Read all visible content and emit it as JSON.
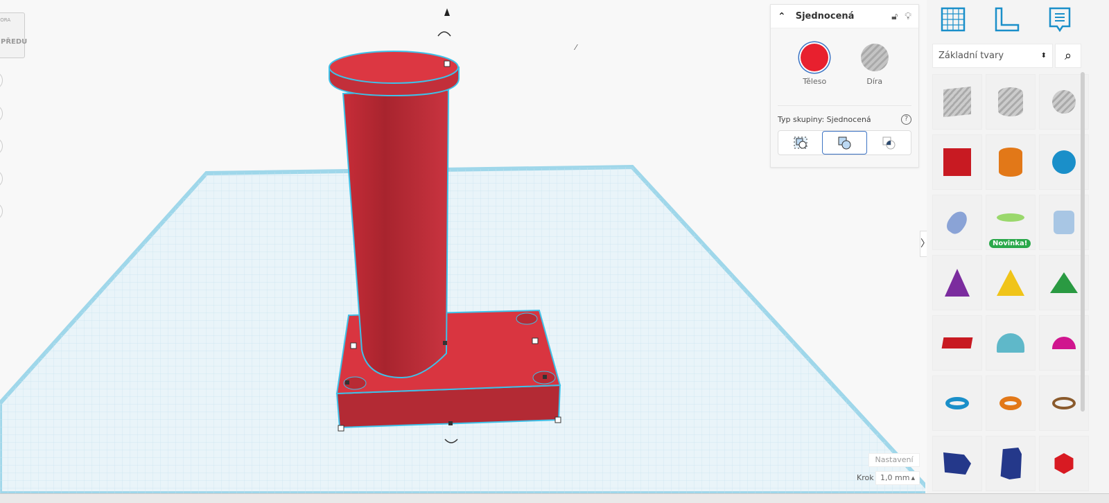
{
  "viewcube": {
    "top": "HORA",
    "front": "PŘEDU"
  },
  "inspector": {
    "title": "Sjednocená",
    "solid_label": "Těleso",
    "hole_label": "Díra",
    "group_type_label": "Typ skupiny: Sjednocená",
    "help": "?",
    "solid_color": "#e8202e"
  },
  "panel": {
    "category": "Základní tvary",
    "new_badge": "Novinka!"
  },
  "footer": {
    "settings": "Nastavení",
    "step_label": "Krok",
    "step_value": "1,0 mm"
  },
  "colors": {
    "accent": "#1a8fc9",
    "object": "#d93540",
    "selection": "#3fc1e8"
  }
}
